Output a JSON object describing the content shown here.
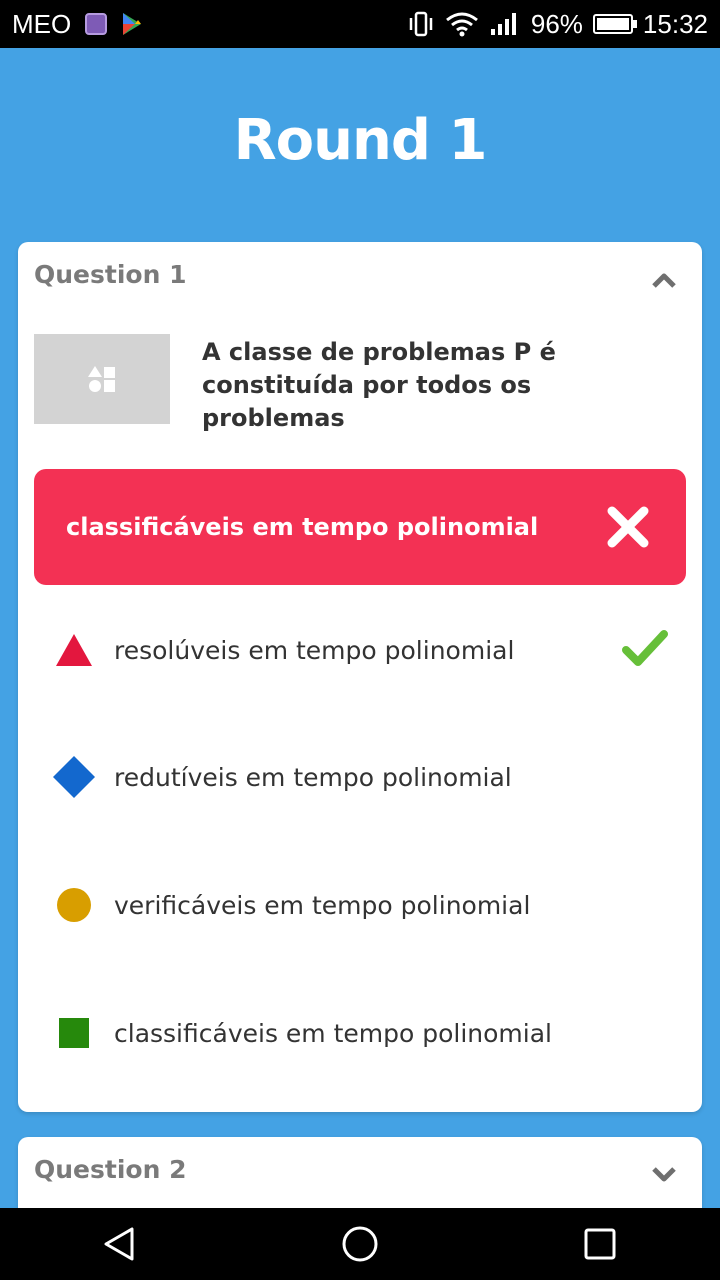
{
  "status_bar": {
    "carrier": "MEO",
    "battery": "96%",
    "time": "15:32",
    "icons": [
      "gallery-icon",
      "play-store-icon",
      "vibrate-icon",
      "wifi-icon",
      "signal-icon",
      "battery-icon"
    ]
  },
  "round": {
    "title": "Round 1"
  },
  "question1": {
    "header": "Question 1",
    "expanded": true,
    "text": "A classe de problemas P é constituída por todos os problemas",
    "selected_answer": {
      "label": "classificáveis em tempo polinomial",
      "result": "wrong"
    },
    "options": [
      {
        "label": "resolúveis em tempo polinomial",
        "shape": "triangle",
        "color": "#e3173e",
        "correct": true
      },
      {
        "label": "redutíveis em tempo polinomial",
        "shape": "diamond",
        "color": "#1368ce",
        "correct": false
      },
      {
        "label": "verificáveis em tempo polinomial",
        "shape": "circle",
        "color": "#d89e00",
        "correct": false
      },
      {
        "label": "classificáveis em tempo polinomial",
        "shape": "square",
        "color": "#26890c",
        "correct": false
      }
    ]
  },
  "question2": {
    "header": "Question 2",
    "expanded": false
  },
  "colors": {
    "background": "#44a2e4",
    "wrong": "#f33154",
    "correct_check": "#66bf39"
  }
}
